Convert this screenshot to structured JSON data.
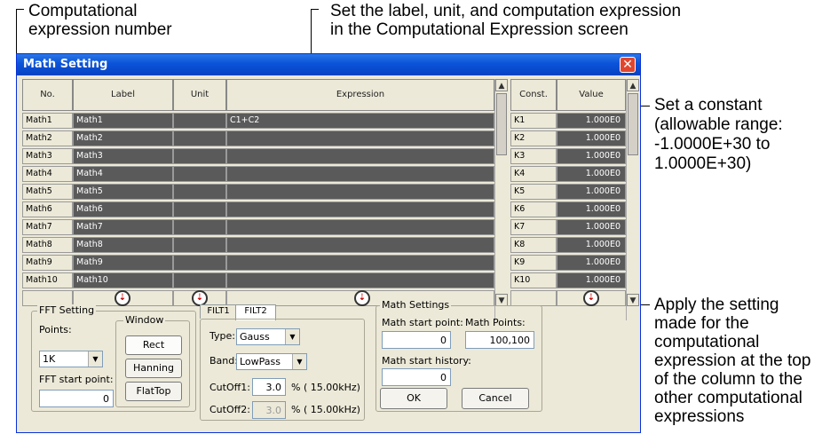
{
  "annotations": {
    "expr_number_line1": "Computational",
    "expr_number_line2": "expression number",
    "set_label_line1": "Set the label, unit, and computation expression",
    "set_label_line2": "in the Computational Expression screen",
    "set_constant_lines": [
      "Set a constant",
      "(allowable range:",
      "-1.0000E+30 to",
      "1.0000E+30)"
    ],
    "apply_lines": [
      "Apply the setting",
      "made for the",
      "computational",
      "expression at the top",
      "of the column to the",
      "other computational",
      "expressions"
    ]
  },
  "window": {
    "title": "Math Setting",
    "close_icon": "close-icon"
  },
  "table": {
    "headers": {
      "no": "No.",
      "label": "Label",
      "unit": "Unit",
      "expression": "Expression",
      "const": "Const.",
      "value": "Value"
    },
    "rows": [
      {
        "no": "Math1",
        "label": "Math1",
        "unit": "",
        "expression": "C1+C2",
        "const": "K1",
        "value": "1.000E0"
      },
      {
        "no": "Math2",
        "label": "Math2",
        "unit": "",
        "expression": "",
        "const": "K2",
        "value": "1.000E0"
      },
      {
        "no": "Math3",
        "label": "Math3",
        "unit": "",
        "expression": "",
        "const": "K3",
        "value": "1.000E0"
      },
      {
        "no": "Math4",
        "label": "Math4",
        "unit": "",
        "expression": "",
        "const": "K4",
        "value": "1.000E0"
      },
      {
        "no": "Math5",
        "label": "Math5",
        "unit": "",
        "expression": "",
        "const": "K5",
        "value": "1.000E0"
      },
      {
        "no": "Math6",
        "label": "Math6",
        "unit": "",
        "expression": "",
        "const": "K6",
        "value": "1.000E0"
      },
      {
        "no": "Math7",
        "label": "Math7",
        "unit": "",
        "expression": "",
        "const": "K7",
        "value": "1.000E0"
      },
      {
        "no": "Math8",
        "label": "Math8",
        "unit": "",
        "expression": "",
        "const": "K8",
        "value": "1.000E0"
      },
      {
        "no": "Math9",
        "label": "Math9",
        "unit": "",
        "expression": "",
        "const": "K9",
        "value": "1.000E0"
      },
      {
        "no": "Math10",
        "label": "Math10",
        "unit": "",
        "expression": "",
        "const": "K10",
        "value": "1.000E0"
      }
    ]
  },
  "fft": {
    "group_label": "FFT Setting",
    "points_label": "Points:",
    "points_value": "1K",
    "start_label": "FFT start point:",
    "start_value": "0",
    "window_label": "Window",
    "window_buttons": [
      "Rect",
      "Hanning",
      "FlatTop"
    ]
  },
  "filter": {
    "tabs": [
      "FILT1",
      "FILT2"
    ],
    "type_label": "Type:",
    "type_value": "Gauss",
    "band_label": "Band:",
    "band_value": "LowPass",
    "cutoff1_label": "CutOff1:",
    "cutoff1_value": "3.0",
    "cutoff1_suffix": "% ( 15.00kHz)",
    "cutoff2_label": "CutOff2:",
    "cutoff2_value": "3.0",
    "cutoff2_suffix": "% ( 15.00kHz)"
  },
  "math": {
    "group_label": "Math Settings",
    "start_point_label": "Math start point:",
    "start_point_value": "0",
    "points_label": "Math Points:",
    "points_value": "100,100",
    "history_label": "Math start history:",
    "history_value": "0",
    "ok_label": "OK",
    "cancel_label": "Cancel"
  }
}
